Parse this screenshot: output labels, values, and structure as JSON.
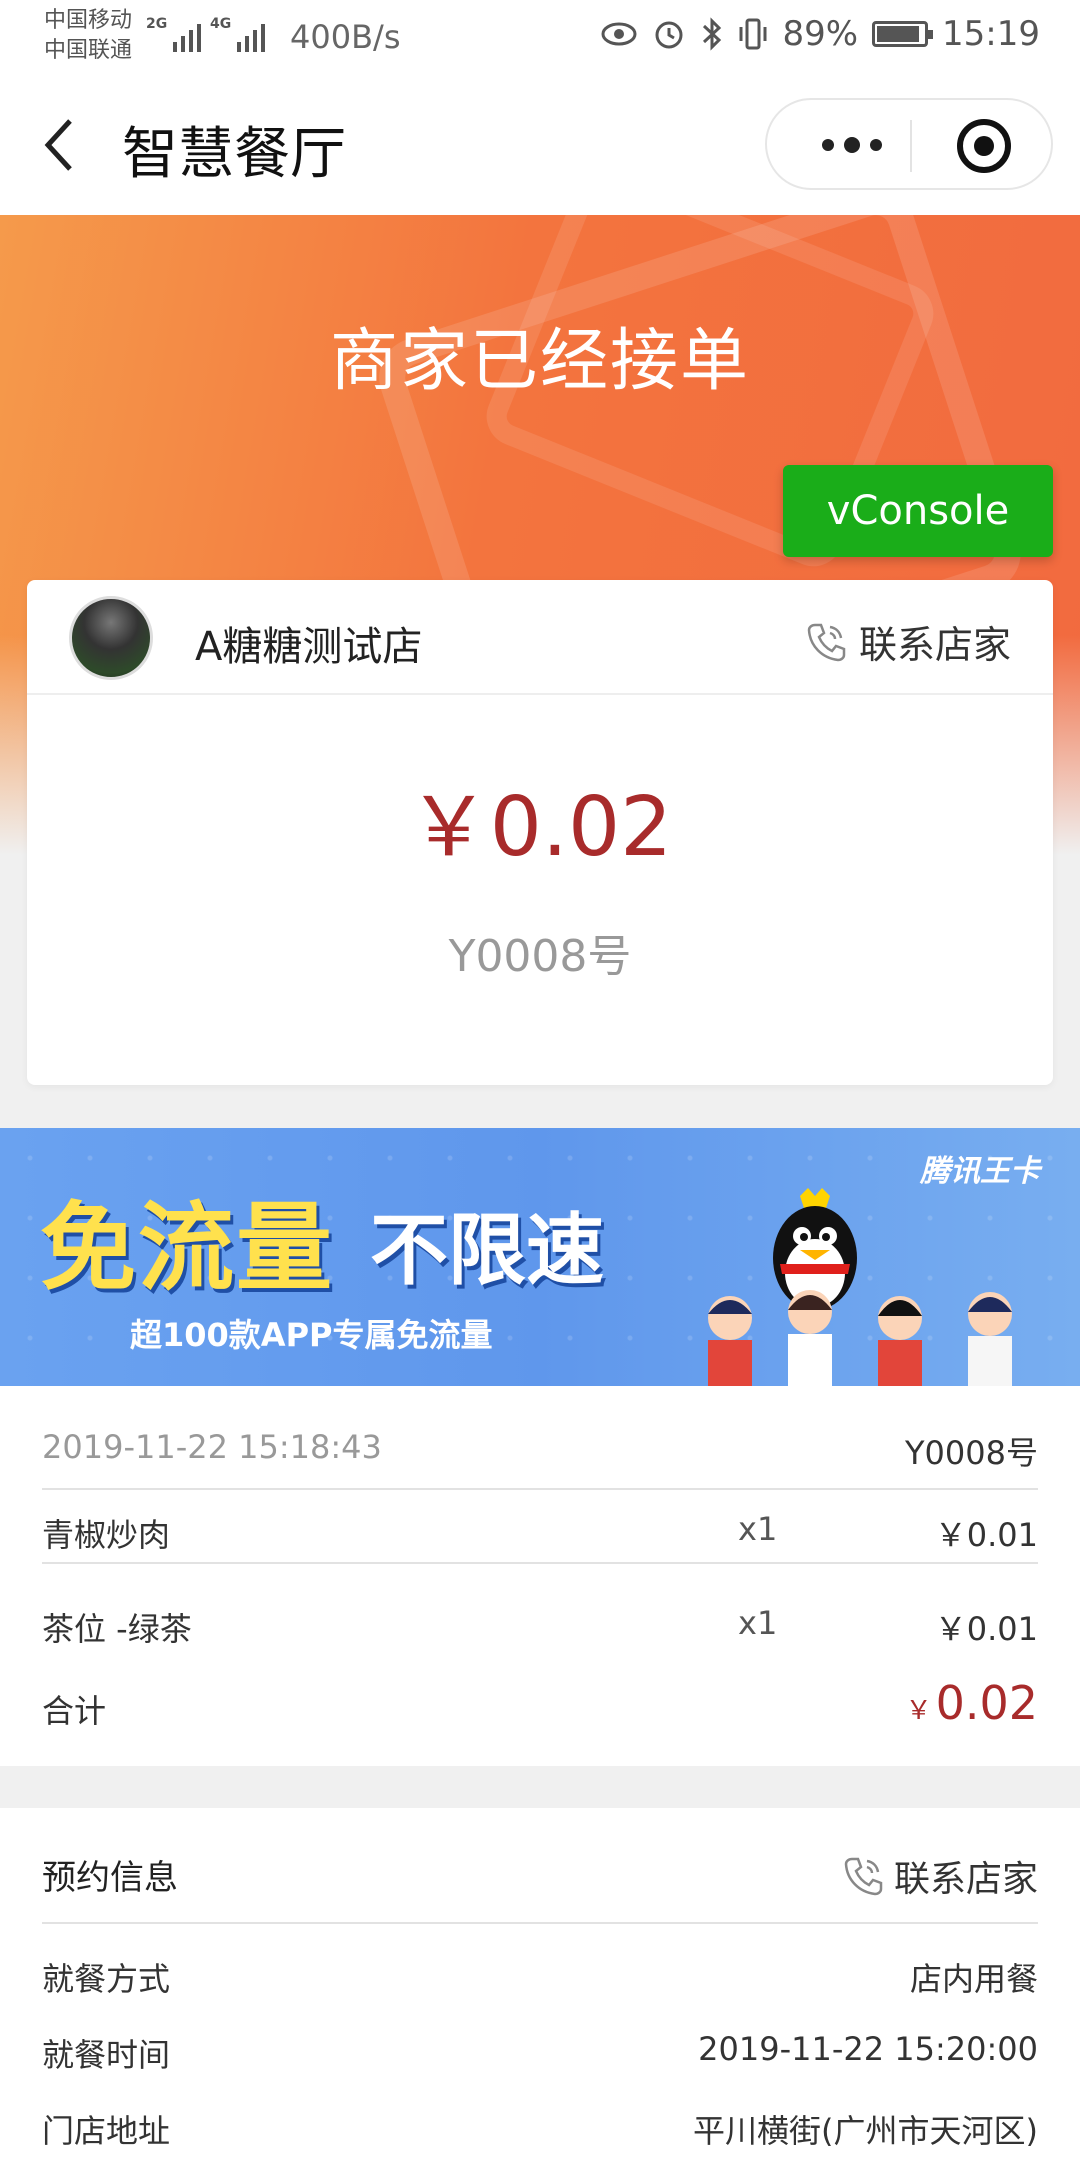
{
  "status_bar": {
    "carrier1": "中国移动",
    "carrier2": "中国联通",
    "net1": "2G",
    "net2": "4G",
    "speed": "400B/s",
    "battery": "89%",
    "time": "15:19"
  },
  "nav": {
    "back_icon": "‹",
    "title": "智慧餐厅"
  },
  "hero": {
    "title": "商家已经接单",
    "vconsole_label": "vConsole"
  },
  "order_card": {
    "shop_name": "A糖糖测试店",
    "contact_label": "联系店家",
    "amount": "￥0.02",
    "order_no": "Y0008号"
  },
  "banner": {
    "headline_a": "免流量",
    "headline_b": "不限速",
    "subline": "超100款APP专属免流量",
    "brand": "腾讯王卡"
  },
  "detail": {
    "time": "2019-11-22 15:18:43",
    "order_no": "Y0008号",
    "items": [
      {
        "name": "青椒炒肉",
        "qty": "x1",
        "price": "￥0.01"
      },
      {
        "name": "茶位 -绿茶",
        "qty": "x1",
        "price": "￥0.01"
      }
    ],
    "total_label": "合计",
    "total_currency": "￥",
    "total_value": "0.02"
  },
  "reservation": {
    "title": "预约信息",
    "contact_label": "联系店家",
    "rows": [
      {
        "label": "就餐方式",
        "value": "店内用餐"
      },
      {
        "label": "就餐时间",
        "value": "2019-11-22 15:20:00"
      },
      {
        "label": "门店地址",
        "value": "平川横街(广州市天河区)"
      }
    ]
  },
  "colors": {
    "accent_red": "#a82b2b",
    "hero_orange": "#f3743e",
    "vconsole_green": "#1aad19",
    "banner_blue": "#5f97ec"
  }
}
